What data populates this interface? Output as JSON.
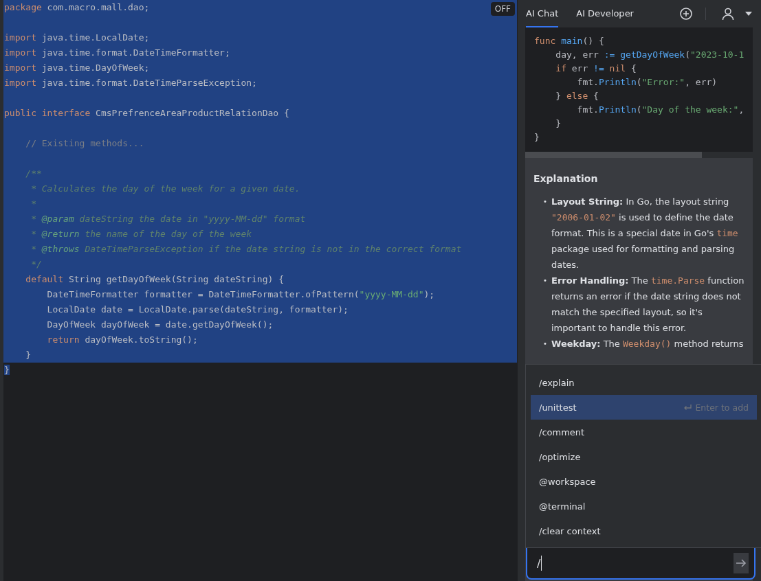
{
  "editor": {
    "badge": "OFF",
    "lines": [
      {
        "selected": true,
        "tokens": [
          {
            "kind": "keyword",
            "text": "package"
          },
          {
            "kind": "plain",
            "text": " com.macro.mall.dao;"
          }
        ]
      },
      {
        "selected": true
      },
      {
        "selected": true,
        "tokens": [
          {
            "kind": "keyword",
            "text": "import"
          },
          {
            "kind": "plain",
            "text": " java.time.LocalDate;"
          }
        ]
      },
      {
        "selected": true,
        "tokens": [
          {
            "kind": "keyword",
            "text": "import"
          },
          {
            "kind": "plain",
            "text": " java.time.format.DateTimeFormatter;"
          }
        ]
      },
      {
        "selected": true,
        "tokens": [
          {
            "kind": "keyword",
            "text": "import"
          },
          {
            "kind": "plain",
            "text": " java.time.DayOfWeek;"
          }
        ]
      },
      {
        "selected": true,
        "tokens": [
          {
            "kind": "keyword",
            "text": "import"
          },
          {
            "kind": "plain",
            "text": " java.time.format.DateTimeParseException;"
          }
        ]
      },
      {
        "selected": true
      },
      {
        "selected": true,
        "tokens": [
          {
            "kind": "keyword",
            "text": "public"
          },
          {
            "kind": "keyword",
            "text": " interface"
          },
          {
            "kind": "plain",
            "text": " CmsPrefrenceAreaProductRelationDao {"
          }
        ]
      },
      {
        "selected": true
      },
      {
        "selected": true,
        "tokens": [
          {
            "kind": "comment",
            "text": "    // Existing methods..."
          }
        ]
      },
      {
        "selected": true
      },
      {
        "selected": true,
        "tokens": [
          {
            "kind": "doc",
            "text": "    /**"
          }
        ]
      },
      {
        "selected": true,
        "tokens": [
          {
            "kind": "doc",
            "text": "     * Calculates the day of the week for a given date."
          }
        ]
      },
      {
        "selected": true,
        "tokens": [
          {
            "kind": "doc",
            "text": "     *"
          }
        ]
      },
      {
        "selected": true,
        "tokens": [
          {
            "kind": "doc",
            "text": "     * "
          },
          {
            "kind": "doctag",
            "text": "@param"
          },
          {
            "kind": "doc",
            "text": " dateString the date in \"yyyy-MM-dd\" format"
          }
        ]
      },
      {
        "selected": true,
        "tokens": [
          {
            "kind": "doc",
            "text": "     * "
          },
          {
            "kind": "doctag",
            "text": "@return"
          },
          {
            "kind": "doc",
            "text": " the name of the day of the week"
          }
        ]
      },
      {
        "selected": true,
        "tokens": [
          {
            "kind": "doc",
            "text": "     * "
          },
          {
            "kind": "doctag",
            "text": "@throws"
          },
          {
            "kind": "doc",
            "text": " DateTimeParseException if the date string is not in the correct format"
          }
        ]
      },
      {
        "selected": true,
        "tokens": [
          {
            "kind": "doc",
            "text": "     */"
          }
        ]
      },
      {
        "selected": true,
        "tokens": [
          {
            "kind": "keyword",
            "text": "    default"
          },
          {
            "kind": "plain",
            "text": " String getDayOfWeek(String dateString) {"
          }
        ]
      },
      {
        "selected": true,
        "tokens": [
          {
            "kind": "plain",
            "text": "        DateTimeFormatter formatter = DateTimeFormatter.ofPattern("
          },
          {
            "kind": "string",
            "text": "\"yyyy-MM-dd\""
          },
          {
            "kind": "plain",
            "text": ");"
          }
        ]
      },
      {
        "selected": true,
        "tokens": [
          {
            "kind": "plain",
            "text": "        LocalDate date = LocalDate.parse(dateString, formatter);"
          }
        ]
      },
      {
        "selected": true,
        "tokens": [
          {
            "kind": "plain",
            "text": "        DayOfWeek dayOfWeek = date.getDayOfWeek();"
          }
        ]
      },
      {
        "selected": true,
        "tokens": [
          {
            "kind": "keyword",
            "text": "        return"
          },
          {
            "kind": "plain",
            "text": " dayOfWeek.toString();"
          }
        ]
      },
      {
        "selected": true,
        "tokens": [
          {
            "kind": "plain",
            "text": "    }"
          }
        ]
      },
      {
        "selected": false,
        "tokens": [
          {
            "kind": "selplain",
            "text": "}"
          }
        ]
      }
    ]
  },
  "chat": {
    "tabs": [
      {
        "label": "AI Chat",
        "selected": true
      },
      {
        "label": "AI Developer",
        "selected": false
      }
    ],
    "code_lines": [
      [
        {
          "kind": "keyword",
          "text": "func"
        },
        {
          "kind": "func",
          "text": " main"
        },
        {
          "kind": "plain",
          "text": "() {"
        }
      ],
      [
        {
          "kind": "plain",
          "text": "    day, err "
        },
        {
          "kind": "func",
          "text": ":= getDayOfWeek"
        },
        {
          "kind": "plain",
          "text": "("
        },
        {
          "kind": "string",
          "text": "\"2023-10-1"
        }
      ],
      [
        {
          "kind": "keyword",
          "text": "    if"
        },
        {
          "kind": "plain",
          "text": " err "
        },
        {
          "kind": "func",
          "text": "!="
        },
        {
          "kind": "keyword",
          "text": " nil"
        },
        {
          "kind": "plain",
          "text": " {"
        }
      ],
      [
        {
          "kind": "plain",
          "text": "        fmt."
        },
        {
          "kind": "func",
          "text": "Println"
        },
        {
          "kind": "plain",
          "text": "("
        },
        {
          "kind": "string",
          "text": "\"Error:\""
        },
        {
          "kind": "plain",
          "text": ", err)"
        }
      ],
      [
        {
          "kind": "plain",
          "text": "    } "
        },
        {
          "kind": "keyword",
          "text": "else"
        },
        {
          "kind": "plain",
          "text": " {"
        }
      ],
      [
        {
          "kind": "plain",
          "text": "        fmt."
        },
        {
          "kind": "func",
          "text": "Println"
        },
        {
          "kind": "plain",
          "text": "("
        },
        {
          "kind": "string",
          "text": "\"Day of the week:\""
        },
        {
          "kind": "plain",
          "text": ","
        }
      ],
      [
        {
          "kind": "plain",
          "text": "    }"
        }
      ],
      [
        {
          "kind": "plain",
          "text": "}"
        }
      ]
    ],
    "heading": "Explanation",
    "bullets": [
      {
        "marker": "•",
        "segments": [
          {
            "kind": "bold",
            "text": "Layout String:"
          },
          {
            "kind": "text",
            "text": " In Go, the layout string "
          },
          {
            "kind": "code",
            "text": "\"2006-01-02\""
          },
          {
            "kind": "text",
            "text": " is used to define the date format. This is a special date in Go's "
          },
          {
            "kind": "code",
            "text": "time"
          },
          {
            "kind": "text",
            "text": " package used for formatting and parsing dates."
          }
        ]
      },
      {
        "marker": "•",
        "segments": [
          {
            "kind": "bold",
            "text": "Error Handling:"
          },
          {
            "kind": "text",
            "text": " The "
          },
          {
            "kind": "code",
            "text": "time.Parse"
          },
          {
            "kind": "text",
            "text": " function returns an error if the date string does not match the specified layout, so it's important to handle this error."
          }
        ]
      },
      {
        "marker": "•",
        "segments": [
          {
            "kind": "bold",
            "text": "Weekday:"
          },
          {
            "kind": "text",
            "text": " The "
          },
          {
            "kind": "code",
            "text": "Weekday()"
          },
          {
            "kind": "text",
            "text": " method returns"
          }
        ]
      }
    ],
    "commands": [
      {
        "label": "/explain",
        "selected": false
      },
      {
        "label": "/unittest",
        "selected": true,
        "hint": "Enter to add"
      },
      {
        "label": "/comment",
        "selected": false
      },
      {
        "label": "/optimize",
        "selected": false
      },
      {
        "label": "@workspace",
        "selected": false
      },
      {
        "label": "@terminal",
        "selected": false
      },
      {
        "label": "/clear context",
        "selected": false
      }
    ],
    "input": {
      "value": "/"
    }
  }
}
